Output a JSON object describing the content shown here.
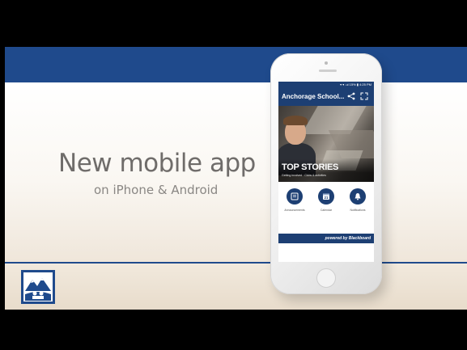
{
  "headline": "New mobile app",
  "subline": "on iPhone & Android",
  "app": {
    "title": "Anchorage School...",
    "status_right": "▾ ▾ .ul 15% ▮ 4:25 PM",
    "hero_title": "TOP STORIES",
    "hero_sub": "Getting involved · Clubs & activities",
    "buttons": [
      {
        "label": "Announcements",
        "icon": "news-icon"
      },
      {
        "label": "Calendar",
        "icon": "calendar-icon",
        "day": "21"
      },
      {
        "label": "Notifications",
        "icon": "bell-icon"
      }
    ],
    "footer": "powered by Blackboard"
  },
  "colors": {
    "brand_blue": "#1f4a8c",
    "text_gray": "#6f6c6a"
  }
}
